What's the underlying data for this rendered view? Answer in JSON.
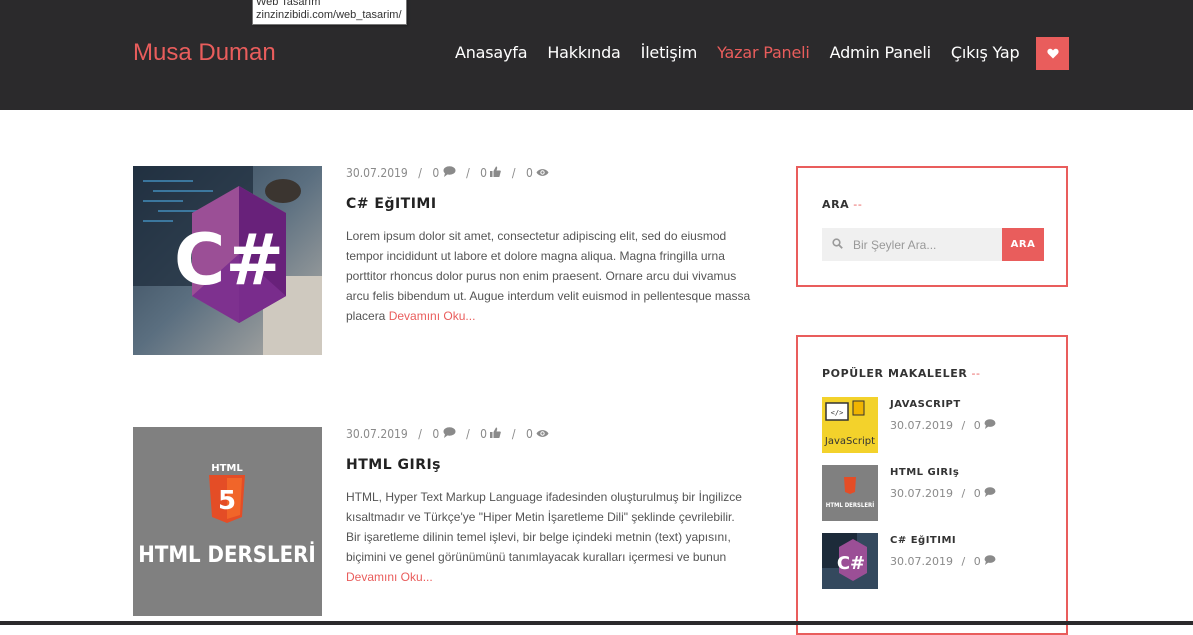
{
  "tooltip": {
    "line1": "Web Tasarım",
    "line2": "zinzinzibidi.com/web_tasarim/"
  },
  "header": {
    "brand": "Musa Duman",
    "nav": [
      {
        "label": "Anasayfa"
      },
      {
        "label": "Hakkında"
      },
      {
        "label": "İletişim"
      },
      {
        "label": "Yazar Paneli"
      },
      {
        "label": "Admin Paneli"
      },
      {
        "label": "Çıkış Yap"
      }
    ],
    "active_nav": "Yazar Paneli",
    "heart_icon": "heart-icon"
  },
  "posts": [
    {
      "date": "30.07.2019",
      "comments": "0",
      "likes": "0",
      "views": "0",
      "title": "C# EğITIMI",
      "excerpt": "Lorem ipsum dolor sit amet, consectetur adipiscing elit, sed do eiusmod tempor incididunt ut labore et dolore magna aliqua. Magna fringilla urna porttitor rhoncus dolor purus non enim praesent. Ornare arcu dui vivamus arcu felis bibendum ut. Augue interdum velit euismod in pellentesque massa placera",
      "more": "Devamını Oku...",
      "image_text": "C#"
    },
    {
      "date": "30.07.2019",
      "comments": "0",
      "likes": "0",
      "views": "0",
      "title": "HTML GIRIş",
      "excerpt": "HTML, Hyper Text Markup Language ifadesinden oluşturulmuş bir İngilizce kısaltmadır ve Türkçe'ye \"Hiper Metin İşaretleme Dili\" şeklinde çevrilebilir. Bir işaretleme dilinin temel işlevi, bir belge içindeki metnin (text) yapısını, biçimini ve genel görünümünü tanımlayacak kuralları içermesi ve bunun",
      "more": "Devamını Oku...",
      "image_label_top": "HTML",
      "image_badge": "5",
      "image_text": "HTML DERSLERİ"
    }
  ],
  "search_widget": {
    "title": "ARA",
    "dash": "--",
    "placeholder": "Bir Şeyler Ara...",
    "button": "ARA"
  },
  "popular_widget": {
    "title": "POPÜLER MAKALELER",
    "dash": "--",
    "items": [
      {
        "title": "JAVASCRIPT",
        "date": "30.07.2019",
        "comments": "0",
        "image_text": "JavaScript"
      },
      {
        "title": "HTML GIRIş",
        "date": "30.07.2019",
        "comments": "0",
        "image_text": "HTML DERSLERİ"
      },
      {
        "title": "C# EğITIMI",
        "date": "30.07.2019",
        "comments": "0",
        "image_text": "C#"
      }
    ]
  },
  "colors": {
    "accent": "#e95d5c",
    "header_bg": "#2b2a2c"
  }
}
